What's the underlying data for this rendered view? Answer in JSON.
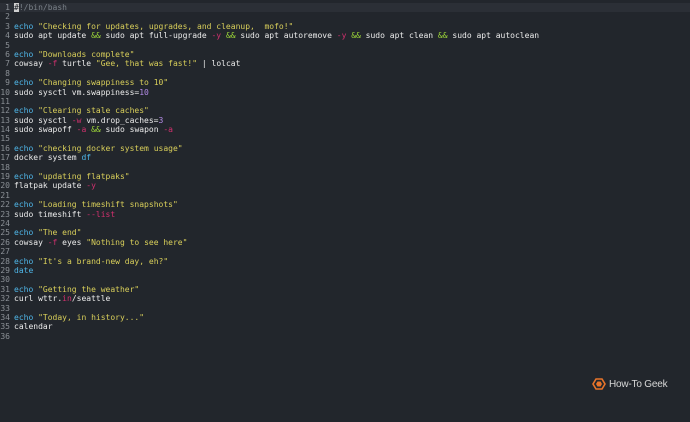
{
  "editor": {
    "lines": [
      {
        "n": "1",
        "tokens": [
          {
            "t": "#!/bin/bash",
            "k": "comment"
          }
        ]
      },
      {
        "n": "2",
        "tokens": []
      },
      {
        "n": "3",
        "tokens": [
          {
            "t": "echo ",
            "k": "cmd"
          },
          {
            "t": "\"Checking for updates, upgrades, and cleanup,  mofo!\"",
            "k": "str"
          }
        ]
      },
      {
        "n": "4",
        "tokens": [
          {
            "t": "sudo apt update ",
            "k": "plain"
          },
          {
            "t": "&&",
            "k": "op"
          },
          {
            "t": " sudo apt full-upgrade ",
            "k": "plain"
          },
          {
            "t": "-y",
            "k": "flag"
          },
          {
            "t": " ",
            "k": "plain"
          },
          {
            "t": "&&",
            "k": "op"
          },
          {
            "t": " sudo apt autoremove ",
            "k": "plain"
          },
          {
            "t": "-y",
            "k": "flag"
          },
          {
            "t": " ",
            "k": "plain"
          },
          {
            "t": "&&",
            "k": "op"
          },
          {
            "t": " sudo apt clean ",
            "k": "plain"
          },
          {
            "t": "&&",
            "k": "op"
          },
          {
            "t": " sudo apt autoclean",
            "k": "plain"
          }
        ]
      },
      {
        "n": "5",
        "tokens": []
      },
      {
        "n": "6",
        "tokens": [
          {
            "t": "echo ",
            "k": "cmd"
          },
          {
            "t": "\"Downloads complete\"",
            "k": "str"
          }
        ]
      },
      {
        "n": "7",
        "tokens": [
          {
            "t": "cowsay ",
            "k": "plain"
          },
          {
            "t": "-f",
            "k": "flag"
          },
          {
            "t": " turtle ",
            "k": "plain"
          },
          {
            "t": "\"Gee, that was fast!\"",
            "k": "str"
          },
          {
            "t": " | lolcat",
            "k": "plain"
          }
        ]
      },
      {
        "n": "8",
        "tokens": []
      },
      {
        "n": "9",
        "tokens": [
          {
            "t": "echo ",
            "k": "cmd"
          },
          {
            "t": "\"Changing swappiness to 10\"",
            "k": "str"
          }
        ]
      },
      {
        "n": "10",
        "tokens": [
          {
            "t": "sudo sysctl vm.swappiness=",
            "k": "plain"
          },
          {
            "t": "10",
            "k": "num"
          }
        ]
      },
      {
        "n": "11",
        "tokens": []
      },
      {
        "n": "12",
        "tokens": [
          {
            "t": "echo ",
            "k": "cmd"
          },
          {
            "t": "\"Clearing stale caches\"",
            "k": "str"
          }
        ]
      },
      {
        "n": "13",
        "tokens": [
          {
            "t": "sudo sysctl ",
            "k": "plain"
          },
          {
            "t": "-w",
            "k": "flag"
          },
          {
            "t": " vm.drop_caches=",
            "k": "plain"
          },
          {
            "t": "3",
            "k": "num"
          }
        ]
      },
      {
        "n": "14",
        "tokens": [
          {
            "t": "sudo swapoff ",
            "k": "plain"
          },
          {
            "t": "-a",
            "k": "flag"
          },
          {
            "t": " ",
            "k": "plain"
          },
          {
            "t": "&&",
            "k": "op"
          },
          {
            "t": " sudo swapon ",
            "k": "plain"
          },
          {
            "t": "-a",
            "k": "flag"
          }
        ]
      },
      {
        "n": "15",
        "tokens": []
      },
      {
        "n": "16",
        "tokens": [
          {
            "t": "echo ",
            "k": "cmd"
          },
          {
            "t": "\"checking docker system usage\"",
            "k": "str"
          }
        ]
      },
      {
        "n": "17",
        "tokens": [
          {
            "t": "docker system ",
            "k": "plain"
          },
          {
            "t": "df",
            "k": "cmd"
          }
        ]
      },
      {
        "n": "18",
        "tokens": []
      },
      {
        "n": "19",
        "tokens": [
          {
            "t": "echo ",
            "k": "cmd"
          },
          {
            "t": "\"updating flatpaks\"",
            "k": "str"
          }
        ]
      },
      {
        "n": "20",
        "tokens": [
          {
            "t": "flatpak update ",
            "k": "plain"
          },
          {
            "t": "-y",
            "k": "flag"
          }
        ]
      },
      {
        "n": "21",
        "tokens": []
      },
      {
        "n": "22",
        "tokens": [
          {
            "t": "echo ",
            "k": "cmd"
          },
          {
            "t": "\"Loading timeshift snapshots\"",
            "k": "str"
          }
        ]
      },
      {
        "n": "23",
        "tokens": [
          {
            "t": "sudo timeshift ",
            "k": "plain"
          },
          {
            "t": "--list",
            "k": "flag"
          }
        ]
      },
      {
        "n": "24",
        "tokens": []
      },
      {
        "n": "25",
        "tokens": [
          {
            "t": "echo ",
            "k": "cmd"
          },
          {
            "t": "\"The end\"",
            "k": "str"
          }
        ]
      },
      {
        "n": "26",
        "tokens": [
          {
            "t": "cowsay ",
            "k": "plain"
          },
          {
            "t": "-f",
            "k": "flag"
          },
          {
            "t": " eyes ",
            "k": "plain"
          },
          {
            "t": "\"Nothing to see here\"",
            "k": "str"
          }
        ]
      },
      {
        "n": "27",
        "tokens": []
      },
      {
        "n": "28",
        "tokens": [
          {
            "t": "echo ",
            "k": "cmd"
          },
          {
            "t": "\"It's a brand-new day, eh?\"",
            "k": "str"
          }
        ]
      },
      {
        "n": "29",
        "tokens": [
          {
            "t": "date",
            "k": "cmd"
          }
        ]
      },
      {
        "n": "30",
        "tokens": []
      },
      {
        "n": "31",
        "tokens": [
          {
            "t": "echo ",
            "k": "cmd"
          },
          {
            "t": "\"Getting the weather\"",
            "k": "str"
          }
        ]
      },
      {
        "n": "32",
        "tokens": [
          {
            "t": "curl wttr.",
            "k": "plain"
          },
          {
            "t": "in",
            "k": "flag"
          },
          {
            "t": "/seattle",
            "k": "plain"
          }
        ]
      },
      {
        "n": "33",
        "tokens": []
      },
      {
        "n": "34",
        "tokens": [
          {
            "t": "echo ",
            "k": "cmd"
          },
          {
            "t": "\"Today, in history...\"",
            "k": "str"
          }
        ]
      },
      {
        "n": "35",
        "tokens": [
          {
            "t": "calendar",
            "k": "plain"
          }
        ]
      },
      {
        "n": "36",
        "tokens": []
      }
    ]
  },
  "watermark": {
    "text": "How-To Geek",
    "icon": "htg-logo-icon",
    "color": "#e8742a"
  },
  "colors": {
    "background": "#22262c",
    "command": "#4fb6e8",
    "string": "#d9cf5a",
    "operator": "#9bd438",
    "flag": "#d2306e",
    "number": "#b48ce8"
  }
}
